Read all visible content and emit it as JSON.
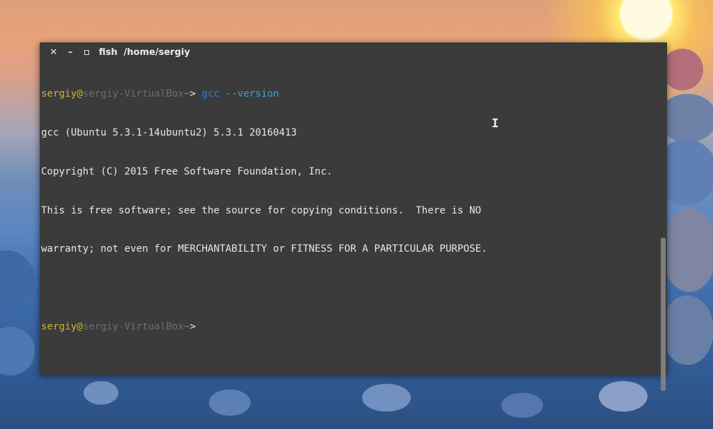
{
  "window": {
    "title": "fish  /home/sergiy",
    "close_glyph": "✕",
    "minimize_glyph": "–"
  },
  "prompt": {
    "user": "sergiy",
    "at": "@",
    "host": "sergiy-VirtualBox",
    "cwd": "~",
    "arrow": ">"
  },
  "command": {
    "name": "gcc",
    "args": "--version"
  },
  "output": [
    "gcc (Ubuntu 5.3.1-14ubuntu2) 5.3.1 20160413",
    "Copyright (C) 2015 Free Software Foundation, Inc.",
    "This is free software; see the source for copying conditions.  There is NO",
    "warranty; not even for MERCHANTABILITY or FITNESS FOR A PARTICULAR PURPOSE."
  ],
  "colors": {
    "user": "#cdb533",
    "host": "#6d6d6d",
    "command": "#2e7fd0",
    "args": "#3aa6d6",
    "terminal_bg": "#3b3b3b"
  },
  "icons": {
    "close": "close-icon",
    "minimize": "minimize-icon",
    "maximize": "maximize-icon",
    "cursor": "text-cursor-icon"
  }
}
